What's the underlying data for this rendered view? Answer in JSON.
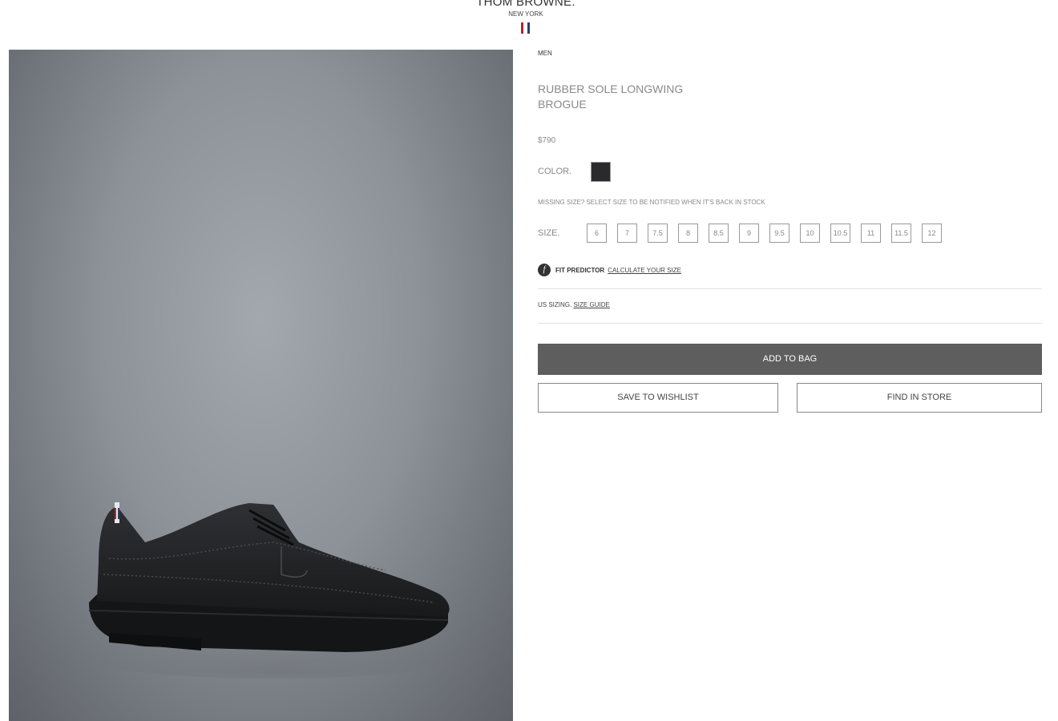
{
  "header": {
    "brand": "THOM BROWNE.",
    "brand_sub": "NEW YORK",
    "flag_colors": [
      "#b4232f",
      "#ffffff",
      "#2c3e6b"
    ]
  },
  "product": {
    "category": "MEN",
    "title": "RUBBER SOLE LONGWING BROGUE",
    "price": "$790",
    "color_label": "COLOR.",
    "color_swatch": "#2a2a2d",
    "missing_size_text": "MISSING SIZE? SELECT SIZE TO BE NOTIFIED WHEN IT'S BACK IN STOCK",
    "size_label": "SIZE.",
    "sizes": [
      "6",
      "7",
      "7.5",
      "8",
      "8.5",
      "9",
      "9.5",
      "10",
      "10.5",
      "11",
      "11.5",
      "12"
    ],
    "fit_icon": "f",
    "fit_predictor_label": "FIT PREDICTOR",
    "fit_predictor_link": "CALCULATE YOUR SIZE",
    "us_sizing_label": "US SIZING.",
    "size_guide_link": "SIZE GUIDE",
    "add_to_bag": "ADD TO BAG",
    "save_to_wishlist": "SAVE TO WISHLIST",
    "find_in_store": "FIND IN STORE"
  }
}
